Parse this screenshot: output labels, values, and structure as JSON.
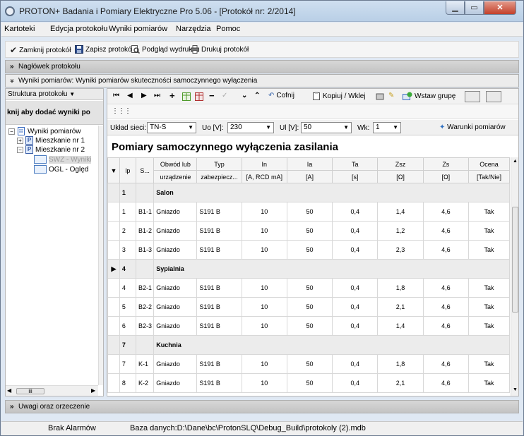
{
  "window": {
    "title": "PROTON+ Badania i Pomiary Elektryczne Pro 5.06 - [Protokół nr: 2/2014]",
    "min_glyph": "▁",
    "max_glyph": "▭",
    "close_glyph": "✕"
  },
  "menu": [
    "Kartoteki",
    "Edycja protokołu",
    "Wyniki pomiarów",
    "Narzędzia",
    "Pomoc"
  ],
  "toolbar": {
    "close_protocol": "Zamknij protokół",
    "save_protocol": "Zapisz protokół",
    "print_preview": "Podgląd wydruku",
    "print_protocol": "Drukuj protokół"
  },
  "sections": {
    "header": "Nagłówek protokołu",
    "results": "Wyniki pomiarów: Wyniki pomiarów skuteczności samoczynnego wyłączenia",
    "remarks": "Uwagi oraz orzeczenie",
    "collapsed_glyph": "»",
    "expanded_glyph": "»"
  },
  "tree": {
    "header": "Struktura protokołu",
    "add_hint": "knij aby dodać wyniki po",
    "items": [
      {
        "label": "Wyniki pomiarów",
        "exp": "−"
      },
      {
        "label": "Mieszkanie nr 1",
        "exp": "+"
      },
      {
        "label": "Mieszkanie nr 2",
        "exp": "−"
      },
      {
        "label": "SWZ - Wyniki"
      },
      {
        "label": "OGL - Oględ"
      }
    ],
    "scroll_thumb": "iii"
  },
  "nav": {
    "undo": "Cofnij",
    "copy_paste": "Kopiuj / Wklej",
    "insert_group": "Wstaw grupę",
    "first": "⏮",
    "prev": "◀",
    "next": "▶",
    "last": "⏭",
    "add": "+",
    "delete": "−",
    "confirm": "✓",
    "down": "⌄",
    "up": "⌃"
  },
  "params": {
    "network_label": "Układ sieci:",
    "network_value": "TN-S",
    "uo_label": "Uo [V]:",
    "uo_value": "230",
    "ul_label": "Ul [V]:",
    "ul_value": "50",
    "wk_label": "Wk:",
    "wk_value": "1",
    "conditions": "Warunki pomiarów"
  },
  "table": {
    "title": "Pomiary samoczynnego wyłączenia zasilania",
    "headers": [
      {
        "top": "lp",
        "bottom": ""
      },
      {
        "top": "S...",
        "bottom": ""
      },
      {
        "top": "Obwód lub",
        "bottom": "urządzenie"
      },
      {
        "top": "Typ",
        "bottom": "zabezpiecz..."
      },
      {
        "top": "In",
        "bottom": "[A, RCD mA]"
      },
      {
        "top": "Ia",
        "bottom": "[A]"
      },
      {
        "top": "Ta",
        "bottom": "[s]"
      },
      {
        "top": "Zsz",
        "bottom": "[Ω]"
      },
      {
        "top": "Zs",
        "bottom": "[Ω]"
      },
      {
        "top": "Ocena",
        "bottom": "[Tak/Nie]"
      }
    ],
    "rows": [
      {
        "group": true,
        "lp": "1",
        "name": "Salon"
      },
      {
        "lp": "1",
        "s": "B1-1",
        "circuit": "Gniazdo",
        "type": "S191 B",
        "in": "10",
        "ia": "50",
        "ta": "0,4",
        "zsz": "1,4",
        "zs": "4,6",
        "ocena": "Tak"
      },
      {
        "lp": "2",
        "s": "B1-2",
        "circuit": "Gniazdo",
        "type": "S191 B",
        "in": "10",
        "ia": "50",
        "ta": "0,4",
        "zsz": "1,2",
        "zs": "4,6",
        "ocena": "Tak"
      },
      {
        "lp": "3",
        "s": "B1-3",
        "circuit": "Gniazdo",
        "type": "S191 B",
        "in": "10",
        "ia": "50",
        "ta": "0,4",
        "zsz": "2,3",
        "zs": "4,6",
        "ocena": "Tak"
      },
      {
        "group": true,
        "selected": true,
        "lp": "4",
        "name": "Sypialnia"
      },
      {
        "lp": "4",
        "s": "B2-1",
        "circuit": "Gniazdo",
        "type": "S191 B",
        "in": "10",
        "ia": "50",
        "ta": "0,4",
        "zsz": "1,8",
        "zs": "4,6",
        "ocena": "Tak"
      },
      {
        "lp": "5",
        "s": "B2-2",
        "circuit": "Gniazdo",
        "type": "S191 B",
        "in": "10",
        "ia": "50",
        "ta": "0,4",
        "zsz": "2,1",
        "zs": "4,6",
        "ocena": "Tak"
      },
      {
        "lp": "6",
        "s": "B2-3",
        "circuit": "Gniazdo",
        "type": "S191 B",
        "in": "10",
        "ia": "50",
        "ta": "0,4",
        "zsz": "1,4",
        "zs": "4,6",
        "ocena": "Tak"
      },
      {
        "group": true,
        "lp": "7",
        "name": "Kuchnia"
      },
      {
        "lp": "7",
        "s": "K-1",
        "circuit": "Gniazdo",
        "type": "S191 B",
        "in": "10",
        "ia": "50",
        "ta": "0,4",
        "zsz": "1,8",
        "zs": "4,6",
        "ocena": "Tak"
      },
      {
        "lp": "8",
        "s": "K-2",
        "circuit": "Gniazdo",
        "type": "S191 B",
        "in": "10",
        "ia": "50",
        "ta": "0,4",
        "zsz": "2,1",
        "zs": "4,6",
        "ocena": "Tak"
      }
    ],
    "sort_glyph": "▼",
    "row_marker": "▶"
  },
  "status": {
    "alarms": "Brak Alarmów",
    "database": "Baza danych:D:\\Dane\\bc\\ProtonSLQ\\Debug_Build\\protokoly (2).mdb"
  },
  "colors": {
    "selection": "#3c8ff0",
    "title_gradient_top": "#cfdff0",
    "close_button": "#c3402a"
  }
}
